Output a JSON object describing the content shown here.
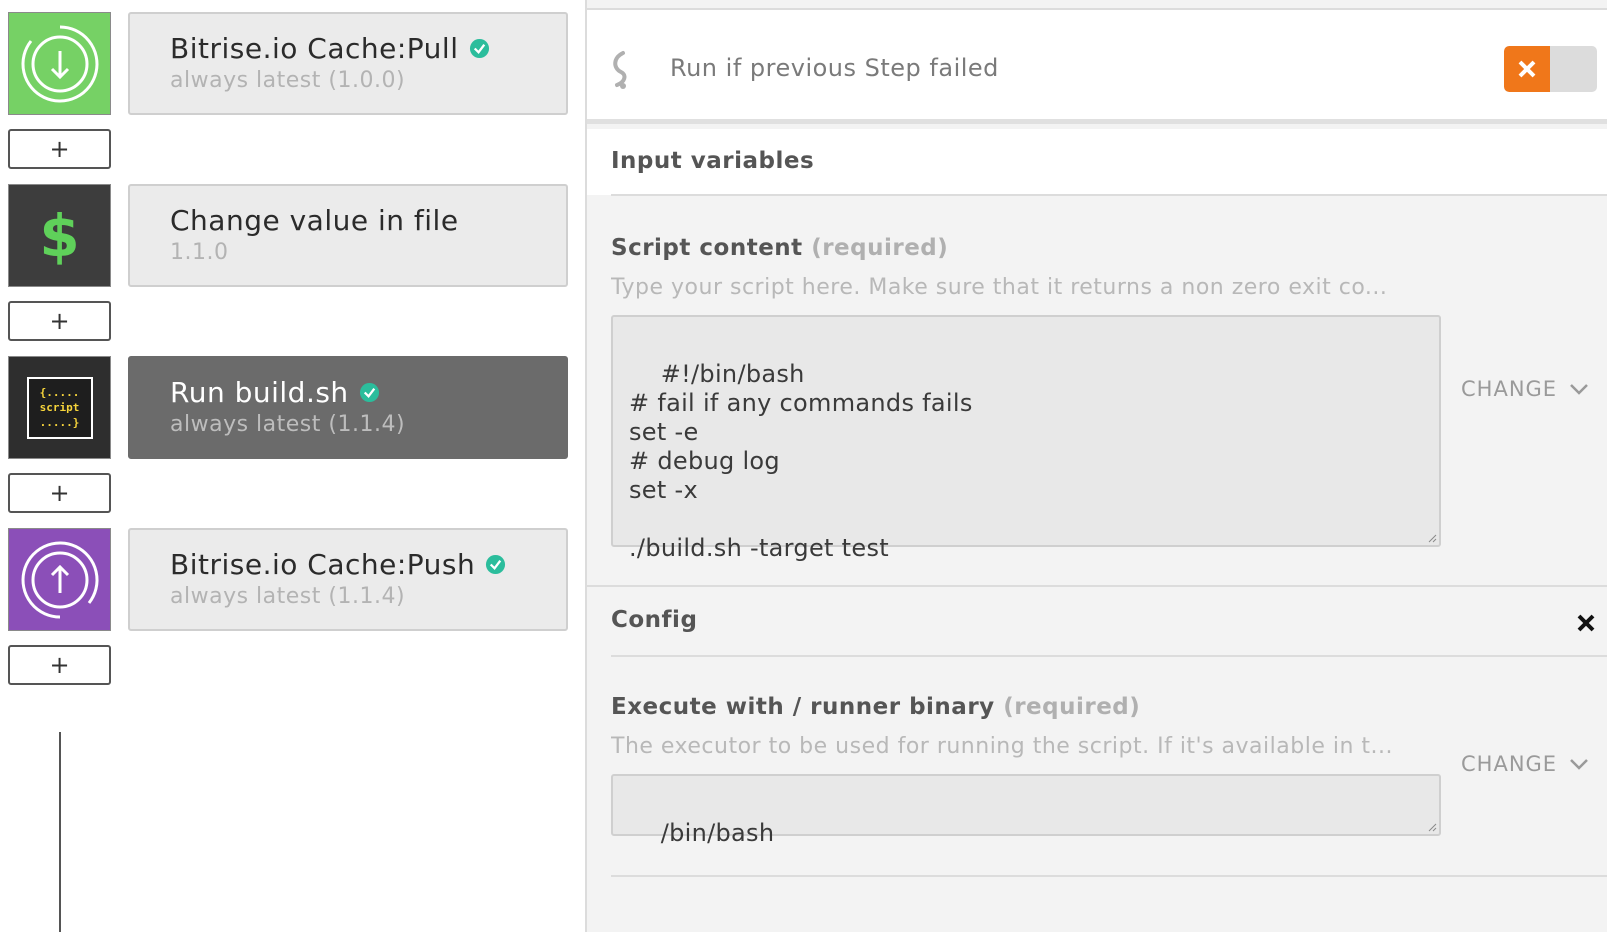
{
  "steps": [
    {
      "title": "Bitrise.io Cache:Pull",
      "version": "always latest (1.0.0)",
      "verified": true,
      "icon": "download-circle-icon",
      "icon_bg": "#76d165",
      "selected": false
    },
    {
      "title": "Change value in file",
      "version": "1.1.0",
      "verified": false,
      "icon": "dollar-icon",
      "icon_bg": "#3d3d3d",
      "selected": false
    },
    {
      "title": "Run build.sh",
      "version": "always latest (1.1.4)",
      "verified": true,
      "icon": "script-icon",
      "icon_bg": "#2e2e2e",
      "selected": true
    },
    {
      "title": "Bitrise.io Cache:Push",
      "version": "always latest (1.1.4)",
      "verified": true,
      "icon": "upload-circle-icon",
      "icon_bg": "#8b4fb8",
      "selected": false
    }
  ],
  "add_step_label": "+",
  "script_icon_text": {
    "line1": "{.....",
    "line2": "script",
    "line3": ".....}"
  },
  "run_if": {
    "label": "Run if previous Step failed",
    "enabled": false,
    "toggle_color": "#f0771a"
  },
  "inputs": {
    "section_title": "Input variables",
    "script_content": {
      "title": "Script content",
      "required": "(required)",
      "description": "Type your script here. Make sure that it returns a non zero exit co...",
      "value": "#!/bin/bash\n# fail if any commands fails\nset -e\n# debug log\nset -x\n\n./build.sh -target test",
      "change_label": "CHANGE"
    }
  },
  "config": {
    "section_title": "Config",
    "runner": {
      "title": "Execute with / runner binary",
      "required": "(required)",
      "description": "The executor to be used for running the script. If it's available in t...",
      "value": "/bin/bash",
      "change_label": "CHANGE"
    }
  },
  "colors": {
    "verified": "#2bbd9c",
    "accent": "#f0771a"
  }
}
